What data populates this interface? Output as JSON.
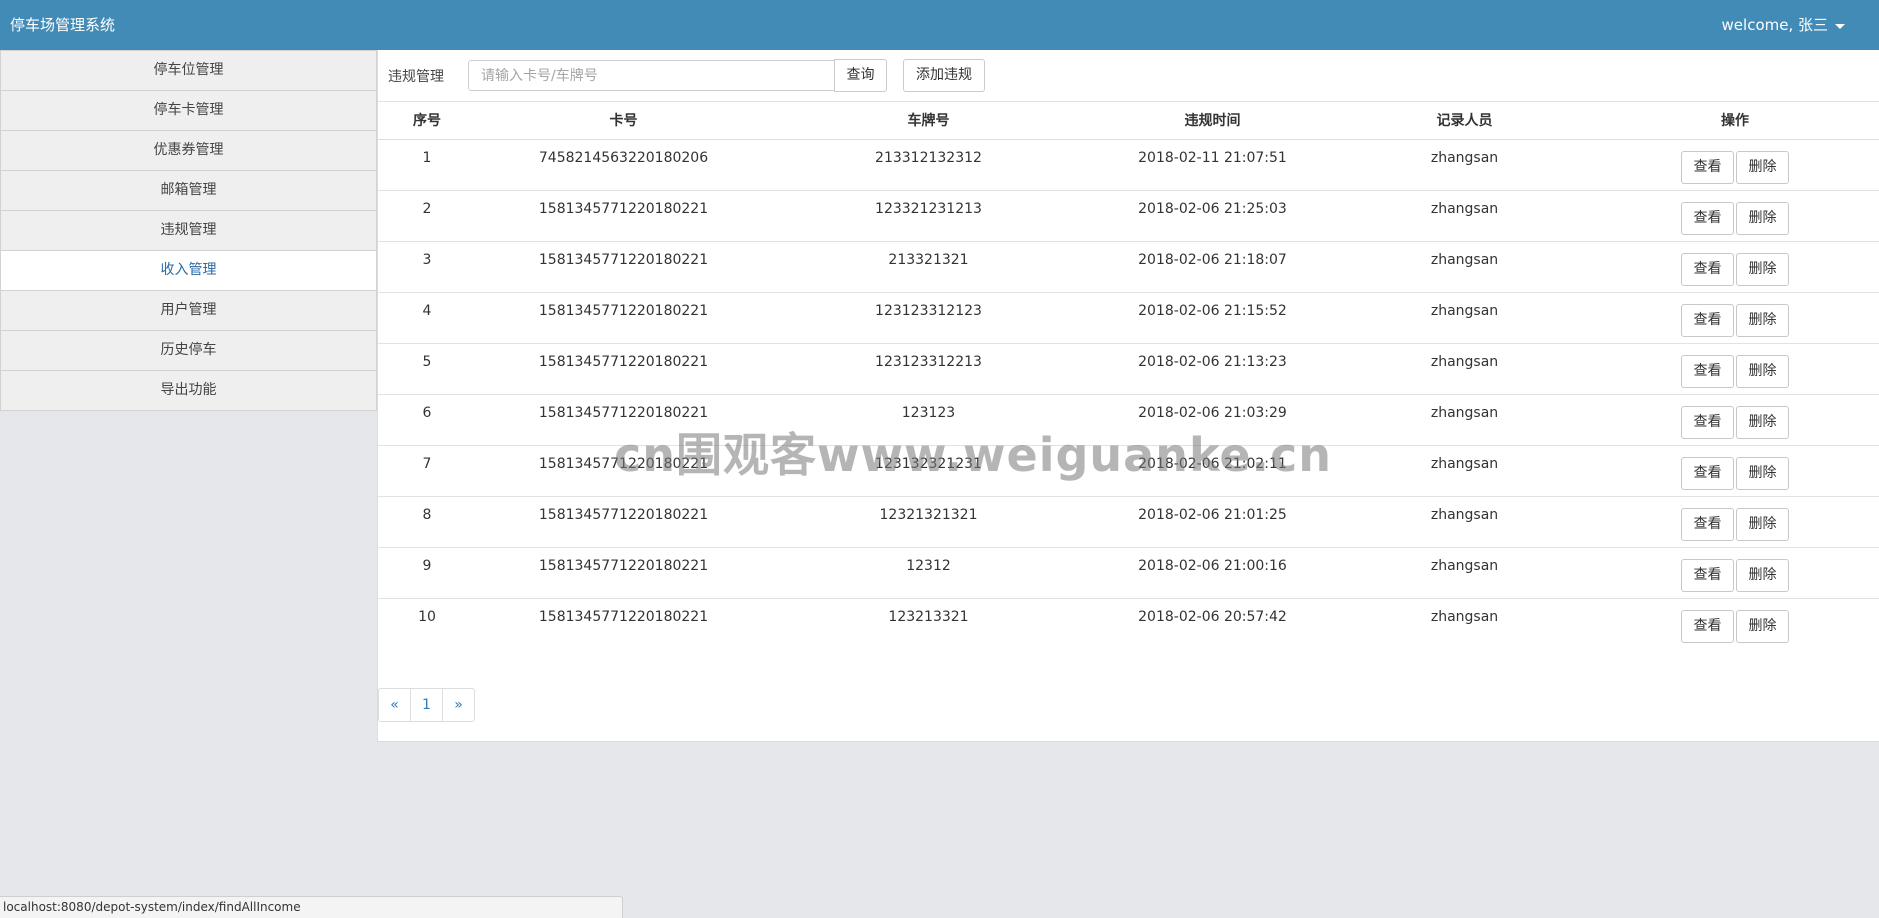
{
  "header": {
    "brand": "停车场管理系统",
    "user_greeting": "welcome, 张三"
  },
  "sidebar": {
    "items": [
      {
        "label": "停车位管理"
      },
      {
        "label": "停车卡管理"
      },
      {
        "label": "优惠券管理"
      },
      {
        "label": "邮箱管理"
      },
      {
        "label": "违规管理"
      },
      {
        "label": "收入管理"
      },
      {
        "label": "用户管理"
      },
      {
        "label": "历史停车"
      },
      {
        "label": "导出功能"
      }
    ],
    "active_label": "收入管理"
  },
  "toolbar": {
    "title": "违规管理",
    "search_placeholder": "请输入卡号/车牌号",
    "search_label": "查询",
    "add_label": "添加违规"
  },
  "table": {
    "headers": [
      "序号",
      "卡号",
      "车牌号",
      "违规时间",
      "记录人员",
      "操作"
    ],
    "rows": [
      {
        "no": "1",
        "card": "7458214563220180206",
        "plate": "213312132312",
        "time": "2018-02-11 21:07:51",
        "recorder": "zhangsan"
      },
      {
        "no": "2",
        "card": "1581345771220180221",
        "plate": "123321231213",
        "time": "2018-02-06 21:25:03",
        "recorder": "zhangsan"
      },
      {
        "no": "3",
        "card": "1581345771220180221",
        "plate": "213321321",
        "time": "2018-02-06 21:18:07",
        "recorder": "zhangsan"
      },
      {
        "no": "4",
        "card": "1581345771220180221",
        "plate": "123123312123",
        "time": "2018-02-06 21:15:52",
        "recorder": "zhangsan"
      },
      {
        "no": "5",
        "card": "1581345771220180221",
        "plate": "123123312213",
        "time": "2018-02-06 21:13:23",
        "recorder": "zhangsan"
      },
      {
        "no": "6",
        "card": "1581345771220180221",
        "plate": "123123",
        "time": "2018-02-06 21:03:29",
        "recorder": "zhangsan"
      },
      {
        "no": "7",
        "card": "1581345771220180221",
        "plate": "123132321231",
        "time": "2018-02-06 21:02:11",
        "recorder": "zhangsan"
      },
      {
        "no": "8",
        "card": "1581345771220180221",
        "plate": "12321321321",
        "time": "2018-02-06 21:01:25",
        "recorder": "zhangsan"
      },
      {
        "no": "9",
        "card": "1581345771220180221",
        "plate": "12312",
        "time": "2018-02-06 21:00:16",
        "recorder": "zhangsan"
      },
      {
        "no": "10",
        "card": "1581345771220180221",
        "plate": "123213321",
        "time": "2018-02-06 20:57:42",
        "recorder": "zhangsan"
      }
    ],
    "view_label": "查看",
    "delete_label": "删除"
  },
  "pagination": {
    "prev": "«",
    "current": "1",
    "next": "»"
  },
  "watermark": "cn围观客www.weiguanke.cn",
  "statusbar": {
    "url": "localhost:8080/depot-system/index/findAllIncome"
  },
  "colors": {
    "header_bg": "#428bb7",
    "active_link": "#2a6aa3",
    "page_link": "#337ab7"
  }
}
